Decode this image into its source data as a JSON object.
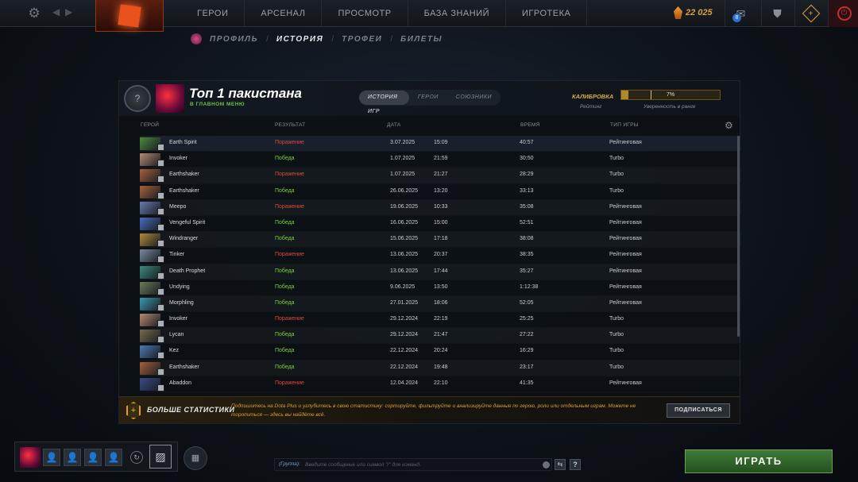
{
  "topbar": {
    "nav": [
      "ГЕРОИ",
      "АРСЕНАЛ",
      "ПРОСМОТР",
      "БАЗА ЗНАНИЙ",
      "ИГРОТЕКА"
    ],
    "shards": "22 025",
    "mail_count": "8",
    "icons": {
      "settings": "gear-icon",
      "back": "chevron-left-icon",
      "forward": "chevron-right-icon",
      "logo": "dota-logo-icon",
      "mail": "mail-icon",
      "armory": "shield-icon",
      "plus": "dota-plus-icon",
      "power": "power-icon"
    }
  },
  "subnav": {
    "items": [
      "ПРОФИЛЬ",
      "ИСТОРИЯ",
      "ТРОФЕИ",
      "БИЛЕТЫ"
    ],
    "active": "ИСТОРИЯ"
  },
  "profile": {
    "name": "Топ 1 пакистана",
    "status": "В ГЛАВНОМ МЕНЮ"
  },
  "tabs": [
    "ИСТОРИЯ ИГР",
    "ГЕРОИ",
    "СОЮЗНИКИ"
  ],
  "active_tab": "ИСТОРИЯ ИГР",
  "calibration": {
    "label": "КАЛИБРОВКА",
    "percent": "7%",
    "progress": 0.07,
    "sub_rating": "Рейтинг",
    "sub_confidence": "Уверенность в ранге"
  },
  "table": {
    "headers": {
      "hero": "ГЕРОЙ",
      "result": "РЕЗУЛЬТАТ",
      "date": "ДАТА",
      "duration": "ВРЕМЯ",
      "mode": "ТИП ИГРЫ"
    },
    "rows": [
      {
        "hero": "Earth Spirit",
        "result": "Поражение",
        "win": false,
        "date": "3.07.2025",
        "time": "15:09",
        "duration": "40:57",
        "mode": "Рейтинговая",
        "color": "#4a8a3a"
      },
      {
        "hero": "Invoker",
        "result": "Победа",
        "win": true,
        "date": "1.07.2025",
        "time": "21:59",
        "duration": "30:50",
        "mode": "Turbo",
        "color": "#b88a70"
      },
      {
        "hero": "Earthshaker",
        "result": "Поражение",
        "win": false,
        "date": "1.07.2025",
        "time": "21:27",
        "duration": "28:29",
        "mode": "Turbo",
        "color": "#a8603a"
      },
      {
        "hero": "Earthshaker",
        "result": "Победа",
        "win": true,
        "date": "26.06.2025",
        "time": "13:20",
        "duration": "33:13",
        "mode": "Turbo",
        "color": "#a8603a"
      },
      {
        "hero": "Meepo",
        "result": "Поражение",
        "win": false,
        "date": "19.06.2025",
        "time": "10:33",
        "duration": "35:08",
        "mode": "Рейтинговая",
        "color": "#6a7ab0"
      },
      {
        "hero": "Vengeful Spirit",
        "result": "Победа",
        "win": true,
        "date": "16.06.2025",
        "time": "15:00",
        "duration": "52:51",
        "mode": "Рейтинговая",
        "color": "#4a6ac0"
      },
      {
        "hero": "Windranger",
        "result": "Победа",
        "win": true,
        "date": "15.06.2025",
        "time": "17:18",
        "duration": "38:08",
        "mode": "Рейтинговая",
        "color": "#b08a3a"
      },
      {
        "hero": "Tinker",
        "result": "Поражение",
        "win": false,
        "date": "13.06.2025",
        "time": "20:37",
        "duration": "38:35",
        "mode": "Рейтинговая",
        "color": "#7a8aa0"
      },
      {
        "hero": "Death Prophet",
        "result": "Победа",
        "win": true,
        "date": "13.06.2025",
        "time": "17:44",
        "duration": "35:27",
        "mode": "Рейтинговая",
        "color": "#3a8a7a"
      },
      {
        "hero": "Undying",
        "result": "Победа",
        "win": true,
        "date": "9.06.2025",
        "time": "13:50",
        "duration": "1:12:38",
        "mode": "Рейтинговая",
        "color": "#6a7a5a"
      },
      {
        "hero": "Morphling",
        "result": "Победа",
        "win": true,
        "date": "27.01.2025",
        "time": "18:06",
        "duration": "52:05",
        "mode": "Рейтинговая",
        "color": "#3a9ab0"
      },
      {
        "hero": "Invoker",
        "result": "Поражение",
        "win": false,
        "date": "29.12.2024",
        "time": "22:19",
        "duration": "25:25",
        "mode": "Turbo",
        "color": "#b88a70"
      },
      {
        "hero": "Lycan",
        "result": "Победа",
        "win": true,
        "date": "29.12.2024",
        "time": "21:47",
        "duration": "27:22",
        "mode": "Turbo",
        "color": "#7a6a4a"
      },
      {
        "hero": "Kez",
        "result": "Победа",
        "win": true,
        "date": "22.12.2024",
        "time": "20:24",
        "duration": "16:29",
        "mode": "Turbo",
        "color": "#4a7ab0"
      },
      {
        "hero": "Earthshaker",
        "result": "Победа",
        "win": true,
        "date": "22.12.2024",
        "time": "19:48",
        "duration": "23:17",
        "mode": "Turbo",
        "color": "#a8603a"
      },
      {
        "hero": "Abaddon",
        "result": "Поражение",
        "win": false,
        "date": "12.04.2024",
        "time": "22:10",
        "duration": "41:35",
        "mode": "Рейтинговая",
        "color": "#3a4a8a"
      }
    ]
  },
  "dota_plus": {
    "title": "БОЛЬШЕ СТАТИСТИКИ",
    "text": "Подпишитесь на Dota Plus и углубитесь в свою статистику: сортируйте, фильтруйте и анализируйте данные по герою, роли или отдельным играм. Можете не торопиться — здесь вы найдёте всё.",
    "button": "ПОДПИСАТЬСЯ"
  },
  "chat": {
    "channel": "(Группа):",
    "placeholder": "Введите сообщение или символ \"/\" для команд."
  },
  "play_button": "ИГРАТЬ"
}
